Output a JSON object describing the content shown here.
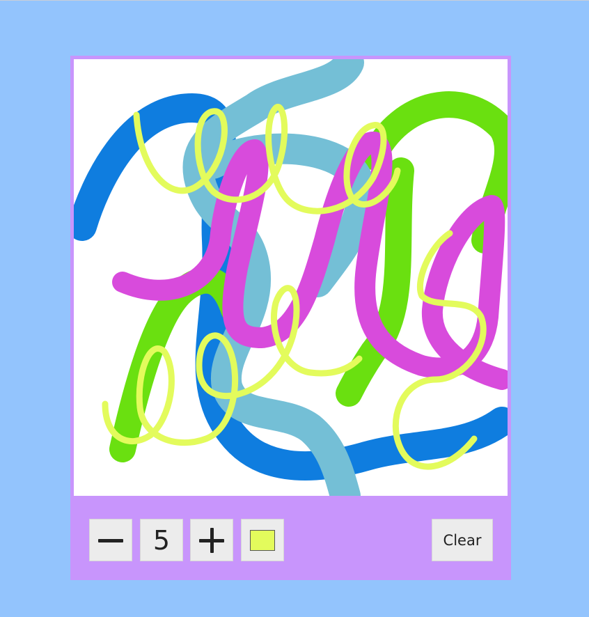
{
  "toolbar": {
    "decrease_icon": "minus-icon",
    "brush_size": "5",
    "increase_icon": "plus-icon",
    "current_color": "#e3fb5c",
    "clear_label": "Clear"
  },
  "colors": {
    "page_background": "#93c4fd",
    "panel_background": "#c895fc",
    "canvas_background": "#ffffff",
    "stroke_blue": "#0f7ddf",
    "stroke_teal": "#74bfd6",
    "stroke_green": "#6ae010",
    "stroke_magenta": "#d84bdc",
    "stroke_yellow": "#e3fb5c"
  }
}
